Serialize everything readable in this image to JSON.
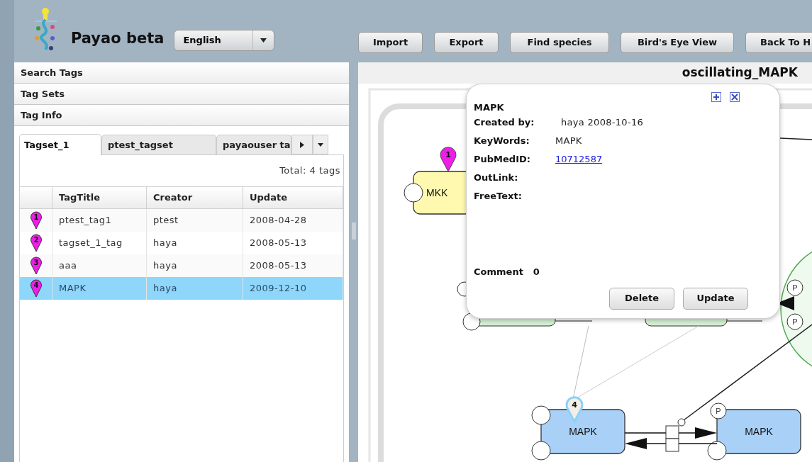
{
  "app": {
    "title": "Payao beta",
    "language": "English"
  },
  "toolbar": [
    "Import",
    "Export",
    "Find species",
    "Bird's Eye View",
    "Back To H"
  ],
  "accordion": [
    {
      "label": "Search Tags"
    },
    {
      "label": "Tag Sets"
    },
    {
      "label": "Tag Info"
    }
  ],
  "tabs": [
    {
      "label": "Tagset_1",
      "selected": true
    },
    {
      "label": "ptest_tagset",
      "selected": false
    },
    {
      "label": "payaouser ta",
      "selected": false
    }
  ],
  "total": "Total: 4 tags",
  "table": {
    "columns": [
      "TagTitle",
      "Creator",
      "Update"
    ],
    "rows": [
      {
        "pin": "1",
        "title": "ptest_tag1",
        "creator": "ptest",
        "update": "2008-04-28",
        "selected": false
      },
      {
        "pin": "2",
        "title": "tagset_1_tag",
        "creator": "haya",
        "update": "2008-05-13",
        "selected": false
      },
      {
        "pin": "3",
        "title": "aaa",
        "creator": "haya",
        "update": "2008-05-13",
        "selected": false
      },
      {
        "pin": "4",
        "title": "MAPK",
        "creator": "haya",
        "update": "2009-12-10",
        "selected": true
      }
    ]
  },
  "diagram": {
    "title": "oscillating_MAPK",
    "nodes": [
      {
        "label": "MKK",
        "color": "#fff9b0"
      },
      {
        "label": "MAPK",
        "color": "#a9d1f7"
      },
      {
        "label": "MAPK",
        "color": "#a9d1f7"
      }
    ],
    "pins": [
      {
        "label": "1",
        "selected": false
      },
      {
        "label": "4",
        "selected": true
      }
    ],
    "state_labels": [
      "P",
      "P",
      "P"
    ]
  },
  "popup": {
    "title": "MAPK",
    "fields": [
      {
        "label": "Created by:",
        "value": "haya 2008-10-16",
        "kind": "text"
      },
      {
        "label": "KeyWords:",
        "value": "MAPK",
        "kind": "text"
      },
      {
        "label": "PubMedID:",
        "value": "10712587",
        "kind": "link"
      },
      {
        "label": "OutLink:"
      },
      {
        "label": "FreeText:"
      }
    ],
    "comment_label": "Comment",
    "comment_count": "0",
    "buttons": [
      "Delete",
      "Update"
    ]
  }
}
